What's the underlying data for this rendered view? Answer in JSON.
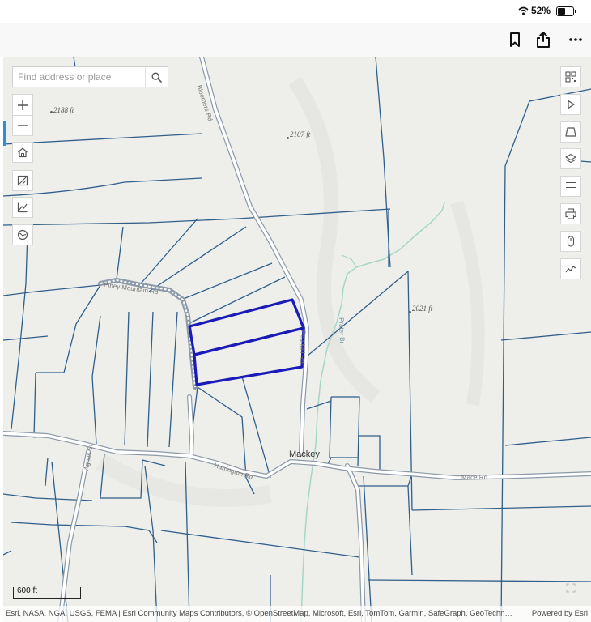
{
  "status_bar": {
    "battery_percent": "52%",
    "battery_level": 0.52,
    "icons": [
      "wifi-icon",
      "battery-icon"
    ]
  },
  "toolbar": {
    "icons": [
      "bookmark-icon",
      "share-icon",
      "more-icon"
    ]
  },
  "map": {
    "search": {
      "placeholder": "Find address or place",
      "value": ""
    },
    "left_controls": [
      "zoom-in",
      "zoom-out",
      "home",
      "legend",
      "measure",
      "basemap"
    ],
    "right_controls": [
      "qr-code",
      "play",
      "draw",
      "layers",
      "list",
      "print",
      "mouse",
      "elevation"
    ],
    "elevation_labels": {
      "e1": "2188 ft",
      "e2": "2107 ft",
      "e3": "2021 ft"
    },
    "place_label": "Mackey",
    "road_labels": {
      "r1": "Bloomers Rd",
      "r2": "Piney Mountain Rd",
      "r3": "Peg Mill Rd",
      "r4": "Harrington Rd",
      "r5": "Mace Rd",
      "r6": "Agnes St"
    },
    "stream_label": "Prater Br",
    "scale_bar": "600 ft",
    "attribution": "Esri, NASA, NGA, USGS, FEMA | Esri Community Maps Contributors, © OpenStreetMap, Microsoft, Esri, TomTom, Garmin, SafeGraph, GeoTechn…",
    "powered_by": "Powered by Esri",
    "colors": {
      "parcel": "#2f5f8a",
      "highlight": "#1a1ab8",
      "road_fill": "#ffffff",
      "road_edge": "#8c99a8",
      "stream": "#a6d6c8",
      "background": "#eeeeeb"
    }
  }
}
